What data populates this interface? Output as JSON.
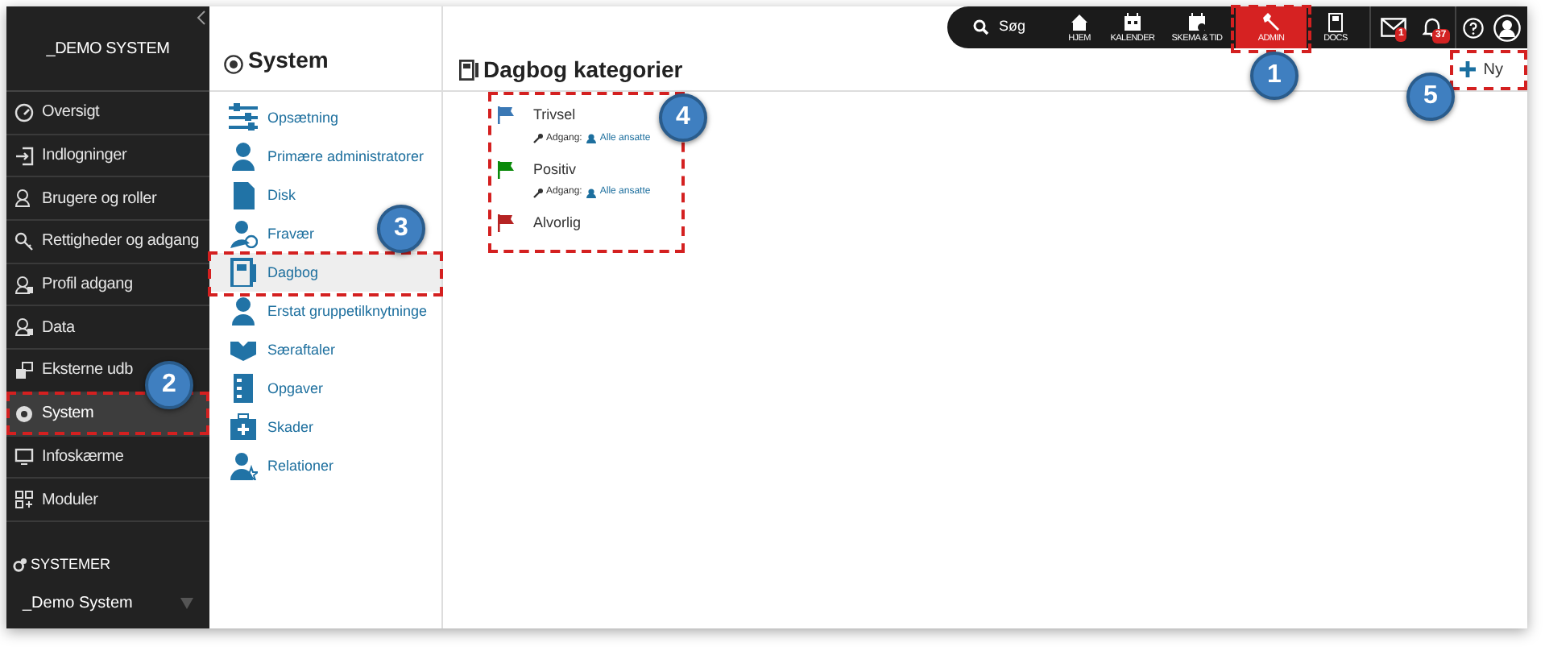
{
  "sidebar": {
    "title": "_DEMO SYSTEM",
    "items": [
      {
        "label": "Oversigt",
        "selected": false
      },
      {
        "label": "Indlogninger",
        "selected": false
      },
      {
        "label": "Brugere og roller",
        "selected": false
      },
      {
        "label": "Rettigheder og adgang",
        "selected": false
      },
      {
        "label": "Profil adgang",
        "selected": false
      },
      {
        "label": "Data",
        "selected": false
      },
      {
        "label": "Eksterne udb",
        "selected": false
      },
      {
        "label": "System",
        "selected": true
      },
      {
        "label": "Infoskærme",
        "selected": false
      },
      {
        "label": "Moduler",
        "selected": false
      }
    ],
    "section_label": "SYSTEMER",
    "system_select": {
      "value": "_Demo System"
    }
  },
  "submenu": {
    "title": "System",
    "items": [
      {
        "label": "Opsætning",
        "selected": false
      },
      {
        "label": "Primære administratorer",
        "selected": false
      },
      {
        "label": "Disk",
        "selected": false
      },
      {
        "label": "Fravær",
        "selected": false
      },
      {
        "label": "Dagbog",
        "selected": true
      },
      {
        "label": "Erstat gruppetilknytninge",
        "selected": false
      },
      {
        "label": "Særaftaler",
        "selected": false
      },
      {
        "label": "Opgaver",
        "selected": false
      },
      {
        "label": "Skader",
        "selected": false
      },
      {
        "label": "Relationer",
        "selected": false
      }
    ]
  },
  "topbar": {
    "search": "Søg",
    "nav": [
      {
        "label": "HJEM",
        "selected": false
      },
      {
        "label": "KALENDER",
        "selected": false
      },
      {
        "label": "SKEMA & TID",
        "selected": false
      },
      {
        "label": "ADMIN",
        "selected": true
      },
      {
        "label": "DOCS",
        "selected": false
      }
    ],
    "mail_badge": "1",
    "notification_badge": "37"
  },
  "content": {
    "title": "Dagbog kategorier",
    "new_button": "Ny",
    "categories": [
      {
        "name": "Trivsel",
        "color": "#3a78b5",
        "access_label": "Adgang:",
        "access_value": "Alle ansatte"
      },
      {
        "name": "Positiv",
        "color": "#0b8a0b",
        "access_label": "Adgang:",
        "access_value": "Alle ansatte"
      },
      {
        "name": "Alvorlig",
        "color": "#b52323"
      }
    ]
  },
  "annotations": [
    {
      "number": "1"
    },
    {
      "number": "2"
    },
    {
      "number": "3"
    },
    {
      "number": "4"
    },
    {
      "number": "5"
    }
  ]
}
